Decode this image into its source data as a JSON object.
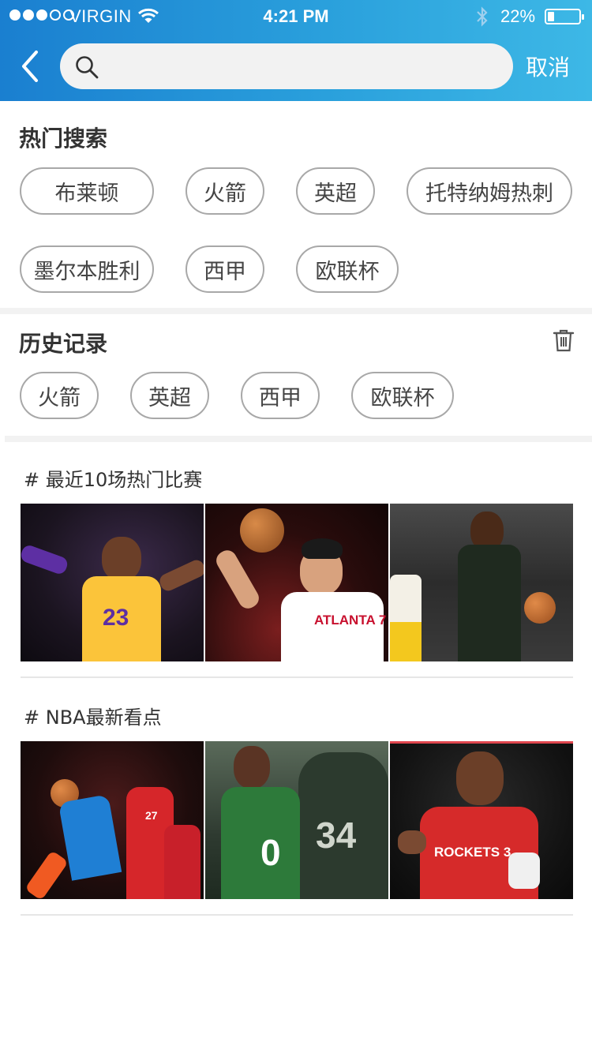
{
  "status_bar": {
    "carrier": "VIRGIN",
    "time": "4:21 PM",
    "battery": "22%",
    "battery_level": 0.22,
    "signal_dots": [
      true,
      true,
      true,
      false,
      false
    ]
  },
  "header": {
    "search_placeholder": "",
    "cancel_label": "取消",
    "colors": {
      "gradient_start": "#1a7fd0",
      "gradient_end": "#3db8e6"
    }
  },
  "hot_search": {
    "title": "热门搜索",
    "chips": [
      "布莱顿",
      "火箭",
      "英超",
      "托特纳姆热刺",
      "墨尔本胜利",
      "西甲",
      "欧联杯"
    ]
  },
  "history": {
    "title": "历史记录",
    "chips": [
      "火箭",
      "英超",
      "西甲",
      "欧联杯"
    ]
  },
  "topics": [
    {
      "title": "# 最近10场热门比赛",
      "images": [
        {
          "name": "lebron-lakers-23",
          "caption": "23",
          "jersey": "#fbc43a"
        },
        {
          "name": "jeremy-lin-atlanta-7",
          "caption": "ATLANTA 7",
          "jersey": "#ffffff"
        },
        {
          "name": "giannis-bucks",
          "caption": "",
          "jersey": "#1f2a1f"
        }
      ]
    },
    {
      "title": "# NBA最新看点",
      "images": [
        {
          "name": "westbrook-thunder-vs-blazers",
          "caption": "27",
          "jersey": "#1f7fd4"
        },
        {
          "name": "tatum-pierce-celtics",
          "caption": "0",
          "jersey": "#2d7a3a"
        },
        {
          "name": "chris-paul-rockets",
          "caption": "ROCKETS 3",
          "jersey": "#d62a2a"
        }
      ]
    }
  ]
}
